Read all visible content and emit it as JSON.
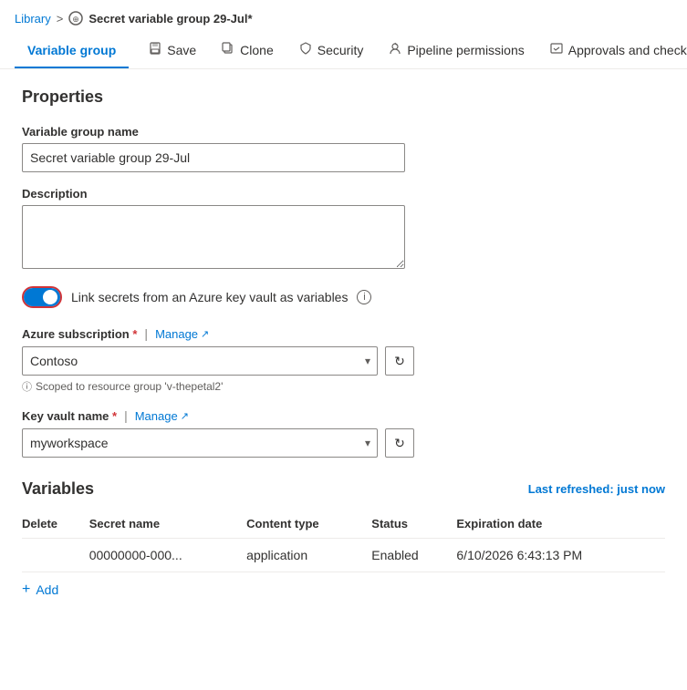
{
  "breadcrumb": {
    "library_label": "Library",
    "separator": ">",
    "icon_label": "variable-group-icon",
    "current_page": "Secret variable group 29-Jul*"
  },
  "toolbar": {
    "tabs": [
      {
        "id": "variable-group",
        "label": "Variable group",
        "icon": "",
        "active": true
      },
      {
        "id": "save",
        "label": "Save",
        "icon": "💾",
        "active": false
      },
      {
        "id": "clone",
        "label": "Clone",
        "icon": "📋",
        "active": false
      },
      {
        "id": "security",
        "label": "Security",
        "icon": "🛡",
        "active": false
      },
      {
        "id": "pipeline-permissions",
        "label": "Pipeline permissions",
        "icon": "🔒",
        "active": false
      },
      {
        "id": "approvals-checks",
        "label": "Approvals and checks",
        "icon": "📄",
        "active": false
      }
    ]
  },
  "properties": {
    "section_title": "Properties",
    "variable_group_name_label": "Variable group name",
    "variable_group_name_value": "Secret variable group 29-Jul",
    "description_label": "Description",
    "description_value": "",
    "description_placeholder": "",
    "toggle_label": "Link secrets from an Azure key vault as variables",
    "toggle_enabled": true
  },
  "azure_subscription": {
    "label": "Azure subscription",
    "required": true,
    "manage_label": "Manage",
    "selected_value": "Contoso",
    "scoped_text": "Scoped to resource group 'v-thepetal2'",
    "refresh_title": "Refresh"
  },
  "key_vault": {
    "label": "Key vault name",
    "required": true,
    "manage_label": "Manage",
    "selected_value": "myworkspace",
    "refresh_title": "Refresh"
  },
  "variables": {
    "section_title": "Variables",
    "last_refreshed": "Last refreshed: just now",
    "columns": [
      "Delete",
      "Secret name",
      "Content type",
      "Status",
      "Expiration date"
    ],
    "rows": [
      {
        "delete": "",
        "secret_name": "00000000-000...",
        "content_type": "application",
        "status": "Enabled",
        "expiration_date": "6/10/2026 6:43:13 PM"
      }
    ],
    "add_label": "Add"
  }
}
